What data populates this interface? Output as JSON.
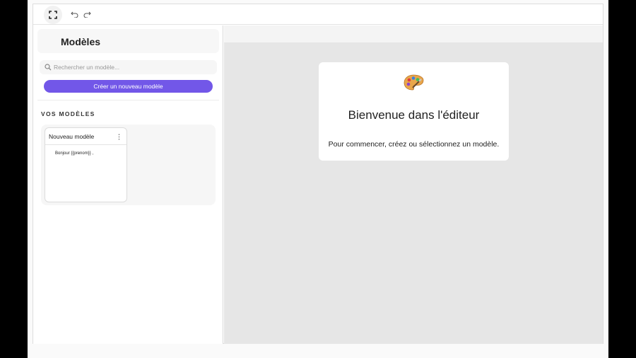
{
  "toolbar": {
    "fullscreen_icon": "expand-icon",
    "undo_icon": "undo-icon",
    "redo_icon": "redo-icon"
  },
  "sidebar": {
    "title": "Modèles",
    "search": {
      "placeholder": "Rechercher un modèle...",
      "value": ""
    },
    "create_label": "Créer un nouveau modèle",
    "section_label": "VOS MODÈLES",
    "templates": [
      {
        "name": "Nouveau modèle",
        "preview": "Bonjour {{prenom}} ,"
      }
    ]
  },
  "main": {
    "welcome_icon": "palette-icon",
    "welcome_title": "Bienvenue dans l'éditeur",
    "welcome_text": "Pour commencer, créez ou sélectionnez un modèle."
  },
  "colors": {
    "accent": "#7257e8",
    "canvas": "#e6e6e6",
    "background": "#ffffff"
  }
}
